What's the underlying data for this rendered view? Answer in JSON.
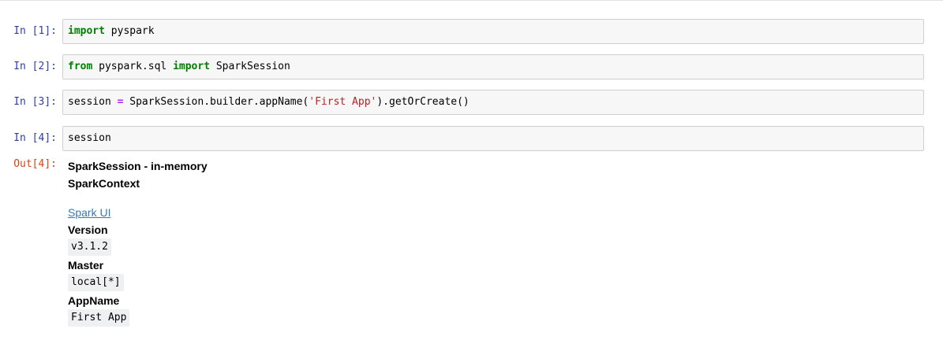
{
  "cells": [
    {
      "prompt": "In [1]:",
      "tokens": [
        {
          "t": "import",
          "c": "kw"
        },
        {
          "t": " pyspark",
          "c": ""
        }
      ]
    },
    {
      "prompt": "In [2]:",
      "tokens": [
        {
          "t": "from",
          "c": "kw"
        },
        {
          "t": " pyspark.sql ",
          "c": ""
        },
        {
          "t": "import",
          "c": "kw"
        },
        {
          "t": " SparkSession",
          "c": ""
        }
      ]
    },
    {
      "prompt": "In [3]:",
      "tokens": [
        {
          "t": "session ",
          "c": ""
        },
        {
          "t": "=",
          "c": "op"
        },
        {
          "t": " SparkSession.builder.appName(",
          "c": ""
        },
        {
          "t": "'First App'",
          "c": "str"
        },
        {
          "t": ").getOrCreate()",
          "c": ""
        }
      ]
    },
    {
      "prompt": "In [4]:",
      "tokens": [
        {
          "t": "session",
          "c": ""
        }
      ]
    }
  ],
  "output": {
    "prompt": "Out[4]:",
    "title": "SparkSession - in-memory",
    "context": "SparkContext",
    "link": "Spark UI",
    "version_label": "Version",
    "version": "v3.1.2",
    "master_label": "Master",
    "master": "local[*]",
    "appname_label": "AppName",
    "appname": "First App"
  }
}
